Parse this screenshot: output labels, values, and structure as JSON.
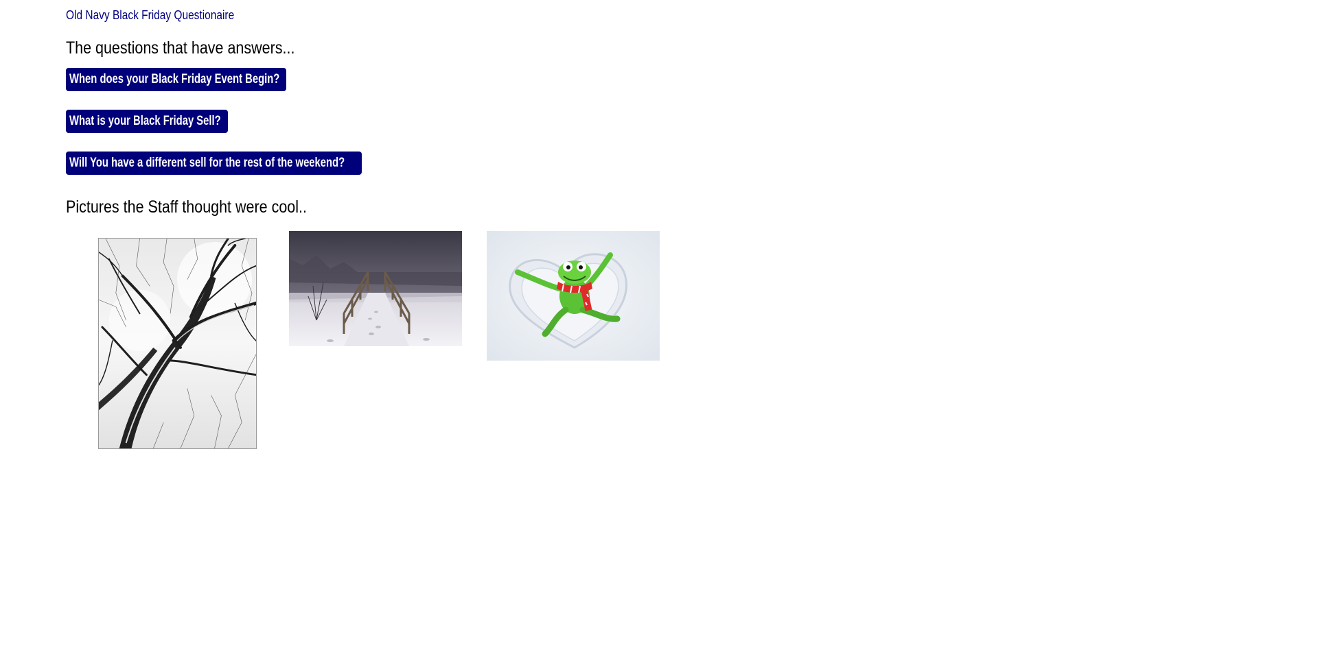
{
  "header": {
    "site_title": "Old Navy Black Friday Questionaire"
  },
  "questions_section": {
    "heading": "The questions that have answers...",
    "buttons": [
      {
        "label": "When does your Black Friday Event Begin?"
      },
      {
        "label": "What is your Black Friday Sell?"
      },
      {
        "label": "Will You have a different sell for the rest of the weekend?"
      }
    ]
  },
  "pictures_section": {
    "heading": "Pictures the Staff thought were cool.."
  },
  "colors": {
    "title_text": "#000080",
    "button_background": "#00007a",
    "button_text": "#ffffff",
    "heading_text": "#000000",
    "page_background": "#ffffff"
  }
}
